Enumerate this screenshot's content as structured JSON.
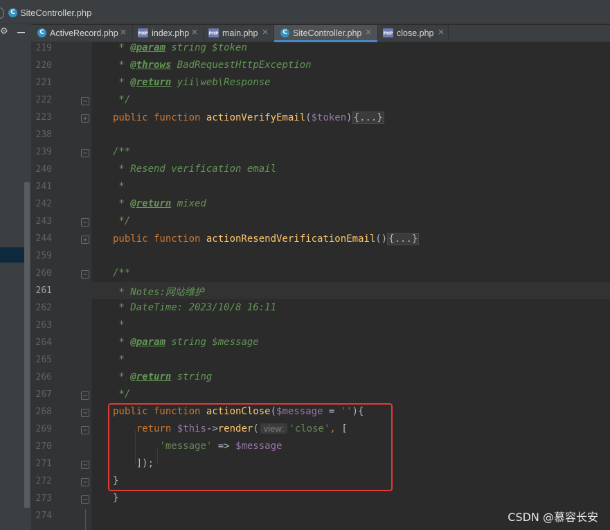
{
  "window": {
    "title": "SiteController.php",
    "title_icon": "C"
  },
  "tabs": [
    {
      "label": "ActiveRecord.php",
      "icon": "class-icon",
      "icon_text": "C",
      "active": false
    },
    {
      "label": "index.php",
      "icon": "php-file-icon",
      "icon_text": "PHP",
      "active": false
    },
    {
      "label": "main.php",
      "icon": "php-file-icon",
      "icon_text": "PHP",
      "active": false
    },
    {
      "label": "SiteController.php",
      "icon": "class-icon",
      "icon_text": "C",
      "active": true
    },
    {
      "label": "close.php",
      "icon": "php-file-icon",
      "icon_text": "PHP",
      "active": false
    }
  ],
  "close_glyph": "×",
  "colors": {
    "keyword": "#cc7832",
    "function": "#ffc66d",
    "variable": "#9876aa",
    "string": "#6a8759",
    "docComment": "#629755",
    "highlightBox": "#e53935",
    "activeTab": "#4a88c7"
  },
  "editor": {
    "current_line": "261",
    "lines": [
      {
        "n": "219",
        "tokens": [
          [
            "doc",
            " * "
          ],
          [
            "tag",
            "@param"
          ],
          [
            "doc",
            " string $token"
          ]
        ]
      },
      {
        "n": "220",
        "tokens": [
          [
            "doc",
            " * "
          ],
          [
            "tag",
            "@throws"
          ],
          [
            "doc",
            " BadRequestHttpException"
          ]
        ]
      },
      {
        "n": "221",
        "tokens": [
          [
            "doc",
            " * "
          ],
          [
            "tag",
            "@return"
          ],
          [
            "doc",
            " yii\\web\\Response"
          ]
        ]
      },
      {
        "n": "222",
        "fold": "end",
        "tokens": [
          [
            "doc",
            " */"
          ]
        ]
      },
      {
        "n": "223",
        "fold": "plus",
        "tokens": [
          [
            "kw",
            "public function "
          ],
          [
            "fn",
            "actionVerifyEmail"
          ],
          [
            "plain",
            "("
          ],
          [
            "var",
            "$token"
          ],
          [
            "plain",
            ")"
          ],
          [
            "box",
            "{...}"
          ]
        ]
      },
      {
        "n": "238",
        "tokens": []
      },
      {
        "n": "239",
        "fold": "start",
        "tokens": [
          [
            "doc",
            "/**"
          ]
        ]
      },
      {
        "n": "240",
        "tokens": [
          [
            "doc",
            " * Resend verification email"
          ]
        ]
      },
      {
        "n": "241",
        "tokens": [
          [
            "doc",
            " *"
          ]
        ]
      },
      {
        "n": "242",
        "tokens": [
          [
            "doc",
            " * "
          ],
          [
            "tag",
            "@return"
          ],
          [
            "doc",
            " mixed"
          ]
        ]
      },
      {
        "n": "243",
        "fold": "end",
        "tokens": [
          [
            "doc",
            " */"
          ]
        ]
      },
      {
        "n": "244",
        "fold": "plus",
        "tokens": [
          [
            "kw",
            "public function "
          ],
          [
            "fn",
            "actionResendVerificationEmail"
          ],
          [
            "plain",
            "()"
          ],
          [
            "box",
            "{...}"
          ]
        ]
      },
      {
        "n": "259",
        "tokens": []
      },
      {
        "n": "260",
        "fold": "start",
        "tokens": [
          [
            "doc",
            "/**"
          ]
        ]
      },
      {
        "n": "261",
        "tokens": [
          [
            "doc",
            " * Notes:网站维护"
          ]
        ]
      },
      {
        "n": "262",
        "tokens": [
          [
            "doc",
            " * DateTime: 2023/10/8 16:11"
          ]
        ]
      },
      {
        "n": "263",
        "tokens": [
          [
            "doc",
            " *"
          ]
        ]
      },
      {
        "n": "264",
        "tokens": [
          [
            "doc",
            " * "
          ],
          [
            "tag",
            "@param"
          ],
          [
            "doc",
            " string $message"
          ]
        ]
      },
      {
        "n": "265",
        "tokens": [
          [
            "doc",
            " *"
          ]
        ]
      },
      {
        "n": "266",
        "tokens": [
          [
            "doc",
            " * "
          ],
          [
            "tag",
            "@return"
          ],
          [
            "doc",
            " string"
          ]
        ]
      },
      {
        "n": "267",
        "fold": "end",
        "tokens": [
          [
            "doc",
            " */"
          ]
        ]
      },
      {
        "n": "268",
        "fold": "start",
        "tokens": [
          [
            "kw",
            "public function "
          ],
          [
            "fn",
            "actionClose"
          ],
          [
            "plain",
            "("
          ],
          [
            "var",
            "$message"
          ],
          [
            "plain",
            " = "
          ],
          [
            "str",
            "''"
          ],
          [
            "plain",
            "){"
          ]
        ]
      },
      {
        "n": "269",
        "fold": "start",
        "tokens": [
          [
            "plain",
            "    "
          ],
          [
            "kw",
            "return "
          ],
          [
            "var",
            "$this"
          ],
          [
            "plain",
            "->"
          ],
          [
            "fn",
            "render"
          ],
          [
            "plain",
            "("
          ],
          [
            "hint",
            "view:"
          ],
          [
            "str",
            "'close'"
          ],
          [
            "kw",
            ", "
          ],
          [
            "plain",
            "["
          ]
        ]
      },
      {
        "n": "270",
        "tokens": [
          [
            "plain",
            "        "
          ],
          [
            "str",
            "'message'"
          ],
          [
            "plain",
            " => "
          ],
          [
            "var",
            "$message"
          ]
        ]
      },
      {
        "n": "271",
        "fold": "end",
        "tokens": [
          [
            "plain",
            "    ]);"
          ]
        ]
      },
      {
        "n": "272",
        "fold": "end",
        "tokens": [
          [
            "plain",
            "}"
          ]
        ]
      },
      {
        "n": "273",
        "fold": "end",
        "tokens": [
          [
            "plain",
            "}"
          ]
        ]
      },
      {
        "n": "274",
        "tokens": []
      }
    ]
  },
  "watermark": "CSDN @慕容长安"
}
